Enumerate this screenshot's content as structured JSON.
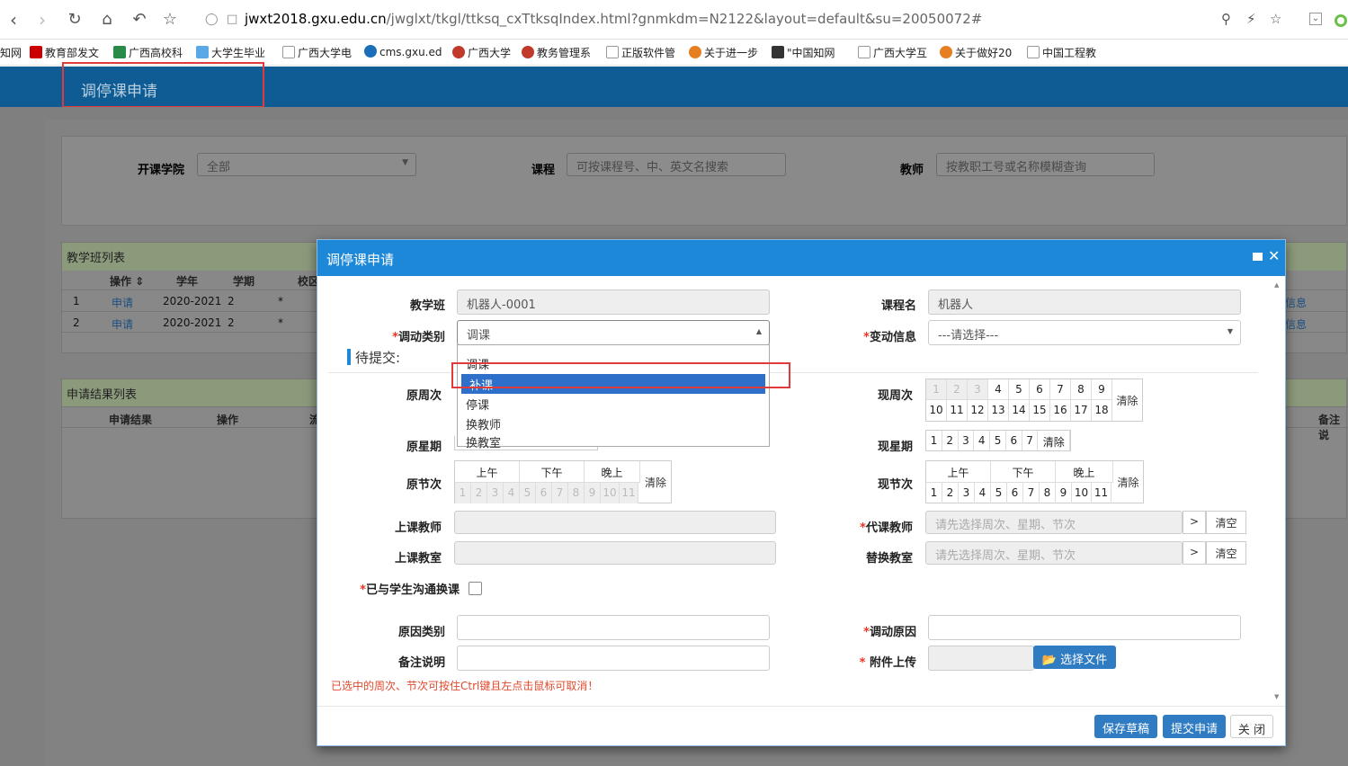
{
  "browser": {
    "url_host": "jwxt2018.gxu.edu.cn",
    "url_path": "/jwglxt/tkgl/ttksq_cxTtksqIndex.html?gnmkdm=N2122&layout=default&su=20050072#",
    "bookmarks": [
      "知网",
      "教育部发文",
      "广西高校科",
      "大学生毕业",
      "广西大学电",
      "cms.gxu.ed",
      "广西大学",
      "教务管理系",
      "正版软件管",
      "关于进一步",
      "\"中国知网",
      "广西大学互",
      "关于做好20",
      "中国工程教"
    ]
  },
  "app": {
    "title": "调停课申请"
  },
  "filters": {
    "college_label": "开课学院",
    "college_value": "全部",
    "course_label": "课程",
    "course_placeholder": "可按课程号、中、英文名搜索",
    "teacher_label": "教师",
    "teacher_placeholder": "按教职工号或名称模糊查询"
  },
  "class_list": {
    "title": "教学班列表",
    "headers": [
      "操作",
      "学年",
      "学期",
      "校区"
    ],
    "rows": [
      {
        "no": "1",
        "op": "申请",
        "year": "2020-2021",
        "term": "2",
        "campus": "*",
        "info": "信息"
      },
      {
        "no": "2",
        "op": "申请",
        "year": "2020-2021",
        "term": "2",
        "campus": "*",
        "info": "信息"
      }
    ]
  },
  "result_list": {
    "title": "申请结果列表",
    "headers": [
      "申请结果",
      "操作",
      "流",
      "备注说"
    ]
  },
  "modal": {
    "title": "调停课申请",
    "class_label": "教学班",
    "class_value": "机器人-0001",
    "course_label": "课程名",
    "course_value": "机器人",
    "type_label": "调动类别",
    "type_value": "调课",
    "type_options": [
      "调课",
      "补课",
      "停课",
      "换教师",
      "换教室"
    ],
    "change_label": "变动信息",
    "change_value": "---请选择---",
    "pending_label": "待提交:",
    "orig_week_label": "原周次",
    "now_week_label": "现周次",
    "weeks_row1": [
      "1",
      "2",
      "3",
      "4",
      "5",
      "6",
      "7",
      "8",
      "9"
    ],
    "weeks_row2": [
      "10",
      "11",
      "12",
      "13",
      "14",
      "15",
      "16",
      "17",
      "18"
    ],
    "clear": "清除",
    "orig_day_label": "原星期",
    "now_day_label": "现星期",
    "days": [
      "1",
      "2",
      "3",
      "4",
      "5",
      "6",
      "7"
    ],
    "orig_period_label": "原节次",
    "now_period_label": "现节次",
    "am": "上午",
    "pm": "下午",
    "eve": "晚上",
    "periods": [
      "1",
      "2",
      "3",
      "4",
      "5",
      "6",
      "7",
      "8",
      "9",
      "10",
      "11"
    ],
    "teacher_label": "上课教师",
    "sub_teacher_label": "代课教师",
    "sub_placeholder": "请先选择周次、星期、节次",
    "room_label": "上课教室",
    "alt_room_label": "替换教室",
    "arrow": ">",
    "clear2": "清空",
    "comm_label": "已与学生沟通换课",
    "reason_type_label": "原因类别",
    "reason_label": "调动原因",
    "note_label": "备注说明",
    "attach_label": "附件上传",
    "choose_file": "选择文件",
    "hint": "已选中的周次、节次可按住Ctrl键且左点击鼠标可取消！",
    "save_draft": "保存草稿",
    "submit": "提交申请",
    "close": "关 闭"
  }
}
